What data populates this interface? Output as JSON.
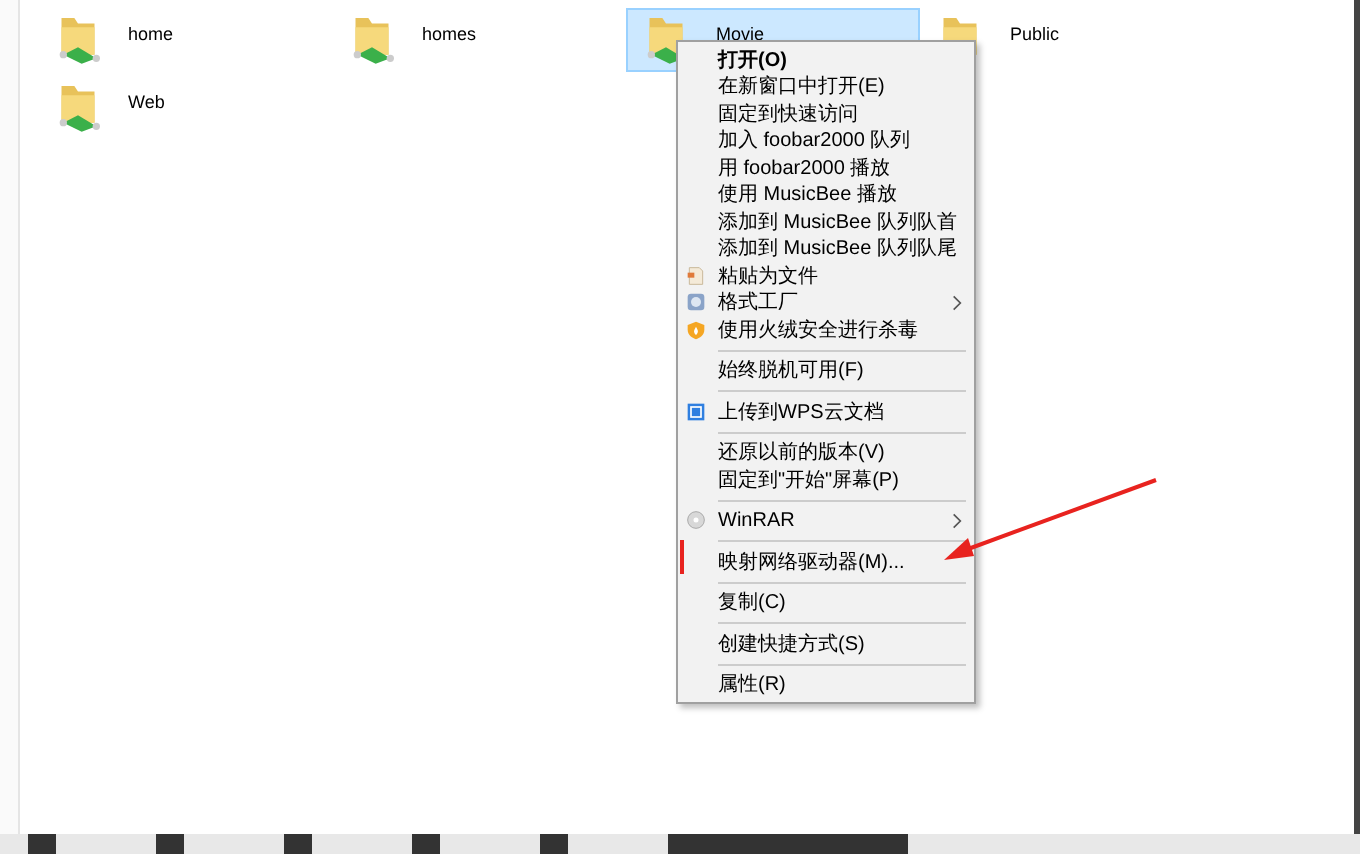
{
  "folders": [
    {
      "name": "home",
      "selected": false,
      "shared": true
    },
    {
      "name": "homes",
      "selected": false,
      "shared": true
    },
    {
      "name": "Movie",
      "selected": true,
      "shared": true
    },
    {
      "name": "Public",
      "selected": false,
      "shared": false
    },
    {
      "name": "Web",
      "selected": false,
      "shared": true
    }
  ],
  "context_menu": {
    "items": [
      {
        "kind": "item",
        "label": "打开(O)",
        "bold": true
      },
      {
        "kind": "item",
        "label": "在新窗口中打开(E)"
      },
      {
        "kind": "item",
        "label": "固定到快速访问"
      },
      {
        "kind": "item",
        "label": "加入 foobar2000 队列"
      },
      {
        "kind": "item",
        "label": "用 foobar2000 播放"
      },
      {
        "kind": "item",
        "label": "使用 MusicBee 播放"
      },
      {
        "kind": "item",
        "label": "添加到 MusicBee 队列队首"
      },
      {
        "kind": "item",
        "label": "添加到 MusicBee 队列队尾"
      },
      {
        "kind": "paste",
        "label": "粘贴为文件"
      },
      {
        "kind": "factory",
        "label": "格式工厂",
        "submenu": true
      },
      {
        "kind": "shield",
        "label": "使用火绒安全进行杀毒"
      },
      {
        "kind": "separator"
      },
      {
        "kind": "item",
        "label": "始终脱机可用(F)"
      },
      {
        "kind": "separator"
      },
      {
        "kind": "cloud",
        "label": "上传到WPS云文档"
      },
      {
        "kind": "separator"
      },
      {
        "kind": "item",
        "label": "还原以前的版本(V)"
      },
      {
        "kind": "item",
        "label": "固定到\"开始\"屏幕(P)"
      },
      {
        "kind": "separator"
      },
      {
        "kind": "disc",
        "label": "WinRAR",
        "submenu": true
      },
      {
        "kind": "separator"
      },
      {
        "kind": "item",
        "label": "映射网络驱动器(M)...",
        "highlighted": true
      },
      {
        "kind": "separator"
      },
      {
        "kind": "item",
        "label": "复制(C)"
      },
      {
        "kind": "separator"
      },
      {
        "kind": "item",
        "label": "创建快捷方式(S)"
      },
      {
        "kind": "separator"
      },
      {
        "kind": "item",
        "label": "属性(R)"
      }
    ]
  }
}
